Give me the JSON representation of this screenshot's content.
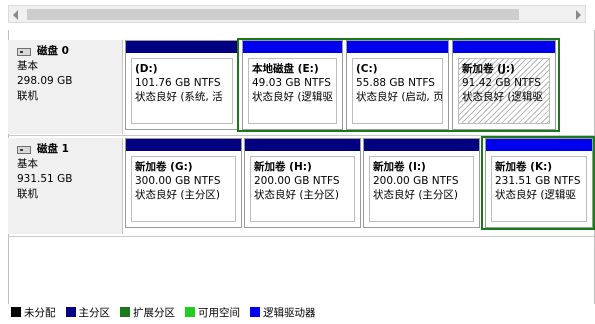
{
  "colors": {
    "unallocated": "#000000",
    "primary": "#000080",
    "extended": "#1a7a1a",
    "free_space": "#22cc22",
    "logical": "#0000ee"
  },
  "disks": [
    {
      "name": "磁盘 0",
      "type": "基本",
      "size": "298.09 GB",
      "status": "联机",
      "icon": "disk-drive-icon",
      "partitions": [
        {
          "label": "(D:)",
          "size": "101.76 GB NTFS",
          "status": "状态良好 (系统, 活"
        },
        {
          "label": "本地磁盘  (E:)",
          "size": "49.03 GB NTFS",
          "status": "状态良好 (逻辑驱"
        },
        {
          "label": "(C:)",
          "size": "55.88 GB NTFS",
          "status": "状态良好 (启动, 页"
        },
        {
          "label": "新加卷  (J:)",
          "size": "91.42 GB NTFS",
          "status": "状态良好 (逻辑驱"
        }
      ]
    },
    {
      "name": "磁盘 1",
      "type": "基本",
      "size": "931.51 GB",
      "status": "联机",
      "icon": "disk-drive-icon",
      "partitions": [
        {
          "label": "新加卷  (G:)",
          "size": "300.00 GB NTFS",
          "status": "状态良好 (主分区)"
        },
        {
          "label": "新加卷  (H:)",
          "size": "200.00 GB NTFS",
          "status": "状态良好 (主分区)"
        },
        {
          "label": "新加卷  (I:)",
          "size": "200.00 GB NTFS",
          "status": "状态良好 (主分区)"
        },
        {
          "label": "新加卷  (K:)",
          "size": "231.51 GB NTFS",
          "status": "状态良好 (逻辑驱"
        }
      ]
    }
  ],
  "legend": [
    {
      "label": "未分配"
    },
    {
      "label": "主分区"
    },
    {
      "label": "扩展分区"
    },
    {
      "label": "可用空间"
    },
    {
      "label": "逻辑驱动器"
    }
  ]
}
